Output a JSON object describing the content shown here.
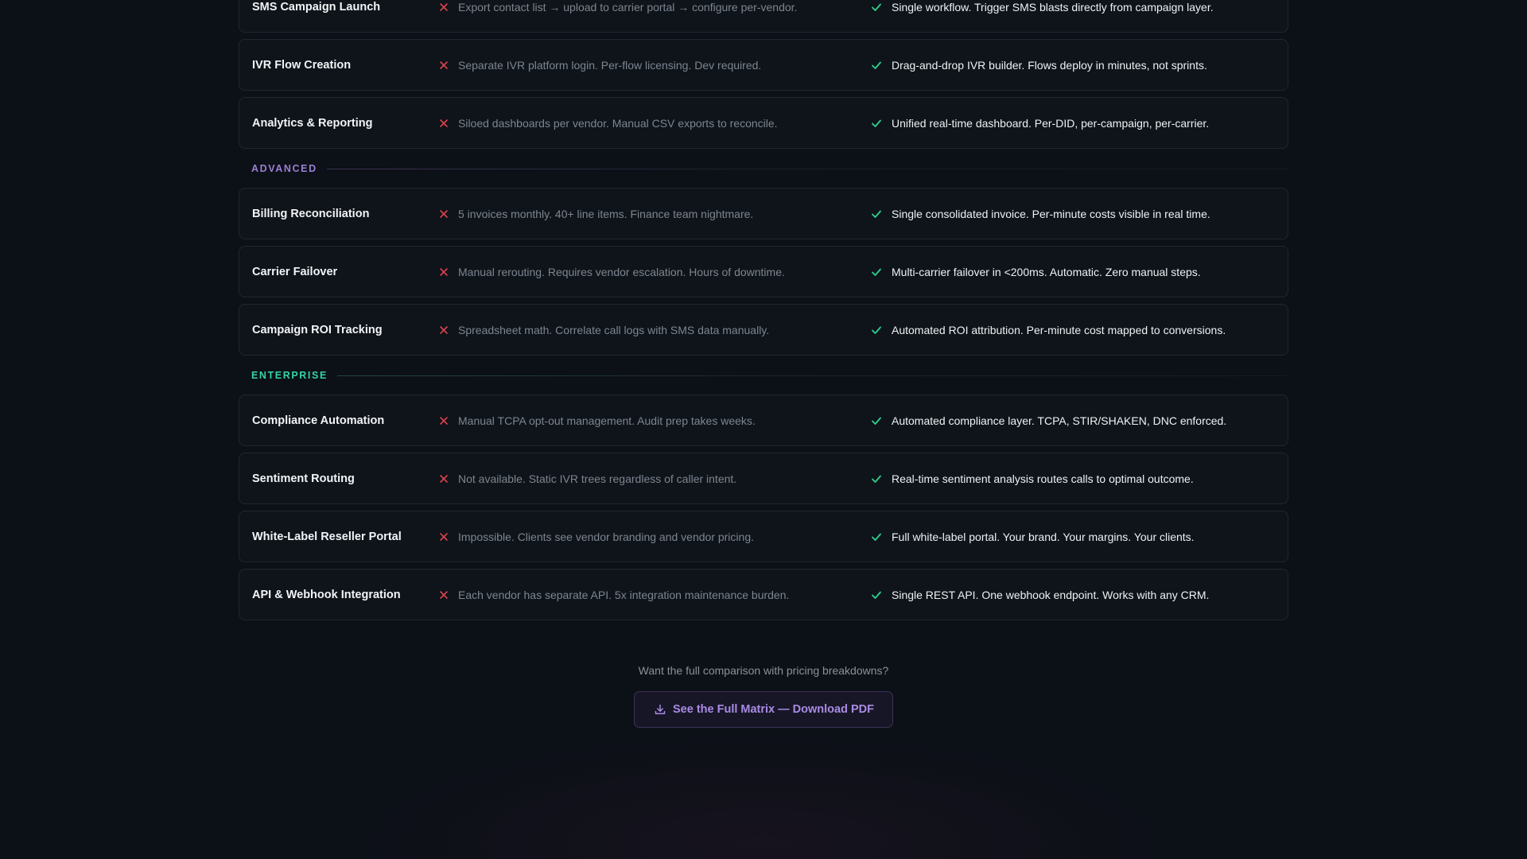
{
  "colors": {
    "accent_purple": "#9b7fd4",
    "accent_teal": "#34d3a6",
    "cross_red": "#d8434e",
    "check_green": "#2fd08f"
  },
  "groups": [
    {
      "label": "",
      "rows": [
        {
          "feature": "SMS Campaign Launch",
          "before": "Export contact list → upload to carrier portal → configure per-vendor.",
          "after": "Single workflow. Trigger SMS blasts directly from campaign layer."
        },
        {
          "feature": "IVR Flow Creation",
          "before": "Separate IVR platform login. Per-flow licensing. Dev required.",
          "after": "Drag-and-drop IVR builder. Flows deploy in minutes, not sprints."
        },
        {
          "feature": "Analytics & Reporting",
          "before": "Siloed dashboards per vendor. Manual CSV exports to reconcile.",
          "after": "Unified real-time dashboard. Per-DID, per-campaign, per-carrier."
        }
      ]
    },
    {
      "label": "ADVANCED",
      "rows": [
        {
          "feature": "Billing Reconciliation",
          "before": "5 invoices monthly. 40+ line items. Finance team nightmare.",
          "after": "Single consolidated invoice. Per-minute costs visible in real time."
        },
        {
          "feature": "Carrier Failover",
          "before": "Manual rerouting. Requires vendor escalation. Hours of downtime.",
          "after": "Multi-carrier failover in <200ms. Automatic. Zero manual steps."
        },
        {
          "feature": "Campaign ROI Tracking",
          "before": "Spreadsheet math. Correlate call logs with SMS data manually.",
          "after": "Automated ROI attribution. Per-minute cost mapped to conversions."
        }
      ]
    },
    {
      "label": "ENTERPRISE",
      "rows": [
        {
          "feature": "Compliance Automation",
          "before": "Manual TCPA opt-out management. Audit prep takes weeks.",
          "after": "Automated compliance layer. TCPA, STIR/SHAKEN, DNC enforced."
        },
        {
          "feature": "Sentiment Routing",
          "before": "Not available. Static IVR trees regardless of caller intent.",
          "after": "Real-time sentiment analysis routes calls to optimal outcome."
        },
        {
          "feature": "White-Label Reseller Portal",
          "before": "Impossible. Clients see vendor branding and vendor pricing.",
          "after": "Full white-label portal. Your brand. Your margins. Your clients."
        },
        {
          "feature": "API & Webhook Integration",
          "before": "Each vendor has separate API. 5x integration maintenance burden.",
          "after": "Single REST API. One webhook endpoint. Works with any CRM."
        }
      ]
    }
  ],
  "cta": {
    "question": "Want the full comparison with pricing breakdowns?",
    "button_label": "See the Full Matrix — Download PDF",
    "button_icon": "download-icon"
  }
}
